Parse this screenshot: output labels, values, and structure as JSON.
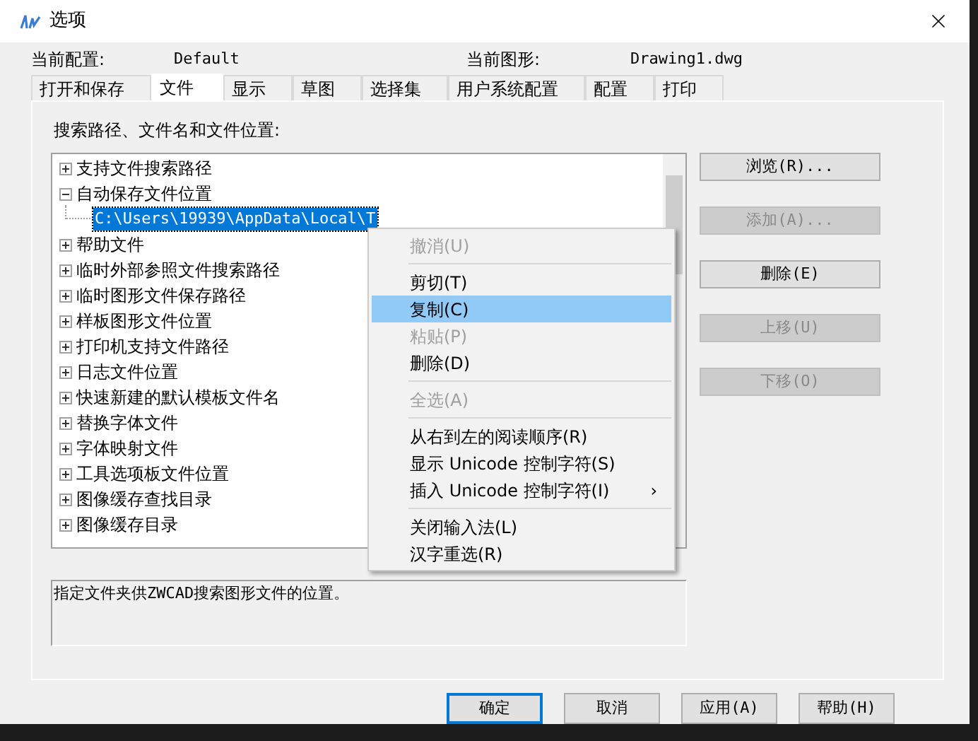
{
  "window": {
    "title": "选项"
  },
  "header": {
    "profile_label": "当前配置:",
    "profile_value": "Default",
    "drawing_label": "当前图形:",
    "drawing_value": "Drawing1.dwg"
  },
  "tabs": [
    {
      "label": "打开和保存",
      "selected": false
    },
    {
      "label": "文件",
      "selected": true
    },
    {
      "label": "显示",
      "selected": false
    },
    {
      "label": "草图",
      "selected": false
    },
    {
      "label": "选择集",
      "selected": false
    },
    {
      "label": "用户系统配置",
      "selected": false
    },
    {
      "label": "配置",
      "selected": false
    },
    {
      "label": "打印",
      "selected": false
    }
  ],
  "panel": {
    "label": "搜索路径、文件名和文件位置:",
    "tree": [
      {
        "label": "支持文件搜索路径",
        "expanded": false
      },
      {
        "label": "自动保存文件位置",
        "expanded": true,
        "children": [
          {
            "label": "C:\\Users\\19939\\AppData\\Local\\T",
            "selected": true
          }
        ]
      },
      {
        "label": "帮助文件",
        "expanded": false
      },
      {
        "label": "临时外部参照文件搜索路径",
        "expanded": false
      },
      {
        "label": "临时图形文件保存路径",
        "expanded": false
      },
      {
        "label": "样板图形文件位置",
        "expanded": false
      },
      {
        "label": "打印机支持文件路径",
        "expanded": false
      },
      {
        "label": "日志文件位置",
        "expanded": false
      },
      {
        "label": "快速新建的默认模板文件名",
        "expanded": false
      },
      {
        "label": "替换字体文件",
        "expanded": false
      },
      {
        "label": "字体映射文件",
        "expanded": false
      },
      {
        "label": "工具选项板文件位置",
        "expanded": false
      },
      {
        "label": "图像缓存查找目录",
        "expanded": false
      },
      {
        "label": "图像缓存目录",
        "expanded": false
      }
    ],
    "description": "指定文件夹供ZWCAD搜索图形文件的位置。",
    "buttons": [
      {
        "label": "浏览(R)...",
        "disabled": false
      },
      {
        "label": "添加(A)...",
        "disabled": true
      },
      {
        "label": "删除(E)",
        "disabled": false
      },
      {
        "label": "上移(U)",
        "disabled": true
      },
      {
        "label": "下移(O)",
        "disabled": true
      }
    ]
  },
  "context_menu": [
    {
      "kind": "item",
      "label": "撤消(U)",
      "disabled": true,
      "selected": false
    },
    {
      "kind": "separator"
    },
    {
      "kind": "item",
      "label": "剪切(T)",
      "disabled": false,
      "selected": false
    },
    {
      "kind": "item",
      "label": "复制(C)",
      "disabled": false,
      "selected": true
    },
    {
      "kind": "item",
      "label": "粘贴(P)",
      "disabled": true,
      "selected": false
    },
    {
      "kind": "item",
      "label": "删除(D)",
      "disabled": false,
      "selected": false
    },
    {
      "kind": "separator"
    },
    {
      "kind": "item",
      "label": "全选(A)",
      "disabled": true,
      "selected": false
    },
    {
      "kind": "separator"
    },
    {
      "kind": "item",
      "label": "从右到左的阅读顺序(R)",
      "disabled": false,
      "selected": false
    },
    {
      "kind": "item",
      "label": "显示 Unicode 控制字符(S)",
      "disabled": false,
      "selected": false
    },
    {
      "kind": "submenu",
      "label": "插入 Unicode 控制字符(I)",
      "arrow": "›",
      "disabled": false,
      "selected": false
    },
    {
      "kind": "separator"
    },
    {
      "kind": "item",
      "label": "关闭输入法(L)",
      "disabled": false,
      "selected": false
    },
    {
      "kind": "item",
      "label": "汉字重选(R)",
      "disabled": false,
      "selected": false
    }
  ],
  "footer_buttons": [
    {
      "label": "确定",
      "default": true
    },
    {
      "label": "取消",
      "default": false
    },
    {
      "label": "应用(A)",
      "default": false
    },
    {
      "label": "帮助(H)",
      "default": false
    }
  ]
}
